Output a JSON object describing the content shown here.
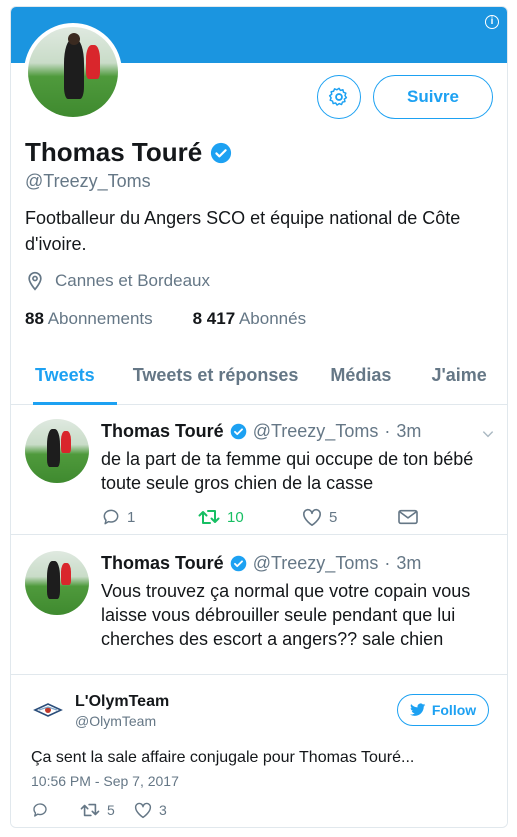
{
  "profile": {
    "name": "Thomas Touré",
    "handle": "@Treezy_Toms",
    "bio": "Footballeur du Angers SCO et équipe national de Côte d'ivoire.",
    "location": "Cannes et Bordeaux",
    "following_count": "88",
    "following_label": "Abonnements",
    "followers_count": "8 417",
    "followers_label": "Abonnés",
    "follow_label": "Suivre"
  },
  "tabs": [
    {
      "label": "Tweets",
      "active": true
    },
    {
      "label": "Tweets et réponses",
      "active": false
    },
    {
      "label": "Médias",
      "active": false
    },
    {
      "label": "J'aime",
      "active": false
    }
  ],
  "tweets": [
    {
      "name": "Thomas Touré",
      "handle": "@Treezy_Toms",
      "time": "3m",
      "text": "de la part de ta femme qui occupe de ton bébé toute seule gros chien de la casse",
      "replies": "1",
      "retweets": "10",
      "likes": "5"
    },
    {
      "name": "Thomas Touré",
      "handle": "@Treezy_Toms",
      "time": "3m",
      "text": "Vous trouvez ça normal que votre copain vous laisse vous débrouiller seule pendant que lui cherches des escort a angers?? sale chien"
    }
  ],
  "embed": {
    "name": "L'OlymTeam",
    "handle": "@OlymTeam",
    "follow_label": "Follow",
    "text": "Ça sent la sale affaire conjugale pour Thomas Touré...",
    "timestamp": "10:56 PM - Sep 7, 2017",
    "retweets": "5",
    "likes": "3"
  },
  "colors": {
    "accent": "#1da1f2",
    "banner": "#1b95e0",
    "retweet_active": "#17bf63",
    "secondary_text": "#657786"
  }
}
